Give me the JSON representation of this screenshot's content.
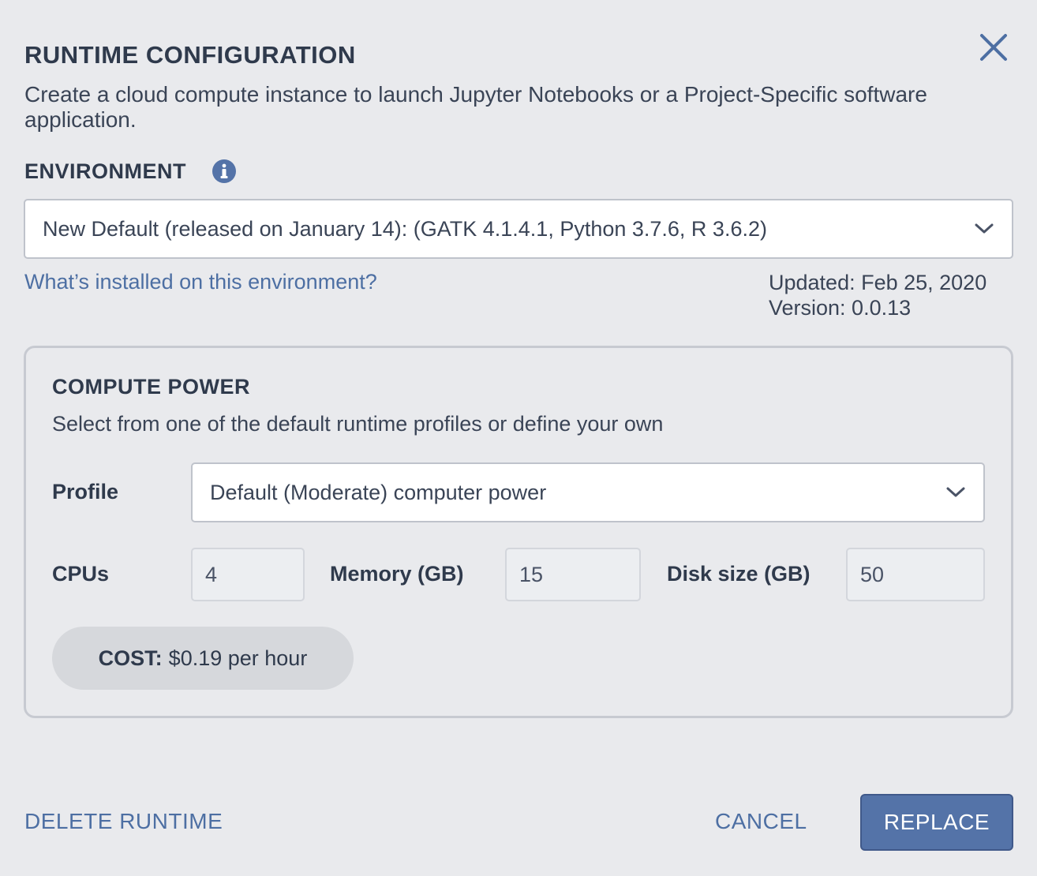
{
  "dialog": {
    "title": "RUNTIME CONFIGURATION",
    "description": "Create a cloud compute instance to launch Jupyter Notebooks or a Project-Specific software application.",
    "close_icon": "close-icon"
  },
  "environment": {
    "label": "ENVIRONMENT",
    "info_icon": "info-icon",
    "selected": "New Default (released on January 14): (GATK 4.1.4.1, Python 3.7.6, R 3.6.2)",
    "link": "What’s installed on this environment?",
    "updated": "Updated: Feb 25, 2020",
    "version": "Version: 0.0.13"
  },
  "compute": {
    "title": "COMPUTE POWER",
    "description": "Select from one of the default runtime profiles or define your own",
    "profile_label": "Profile",
    "profile_selected": "Default (Moderate) computer power",
    "cpus_label": "CPUs",
    "cpus_value": "4",
    "memory_label": "Memory (GB)",
    "memory_value": "15",
    "disk_label": "Disk size (GB)",
    "disk_value": "50",
    "cost_label": "COST:",
    "cost_value": "$0.19 per hour"
  },
  "footer": {
    "delete_label": "DELETE RUNTIME",
    "cancel_label": "CANCEL",
    "replace_label": "REPLACE"
  },
  "colors": {
    "background": "#e9eaed",
    "accent": "#4d6fa3",
    "primary_button": "#5473a8"
  }
}
